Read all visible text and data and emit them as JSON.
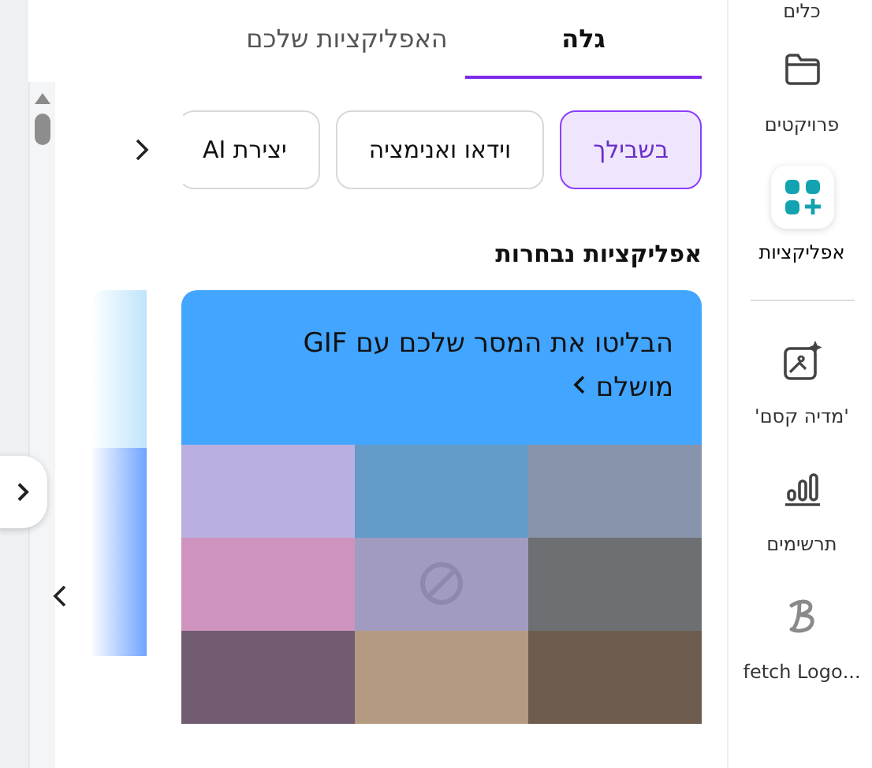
{
  "tabs": [
    {
      "label": "גלה",
      "selected": true
    },
    {
      "label": "האפליקציות שלכם",
      "selected": false
    }
  ],
  "chips": [
    {
      "label": "בשבילך",
      "selected": true
    },
    {
      "label": "וידאו ואנימציה",
      "selected": false
    },
    {
      "label": "יצירת AI",
      "selected": false
    }
  ],
  "section_title": "אפליקציות נבחרות",
  "featured_card": {
    "title": "הבליטו את המסר שלכם עם GIF מושלם",
    "kind": "picture"
  },
  "sidebar": {
    "items": [
      {
        "label": "כלים",
        "kind": "tools",
        "selected": false
      },
      {
        "label": "פרויקטים",
        "kind": "folder",
        "selected": false
      },
      {
        "label": "אפליקציות",
        "kind": "apps",
        "selected": true
      },
      {
        "label": "'מדיה קסם'",
        "kind": "magic",
        "selected": false
      },
      {
        "label": "תרשימים",
        "kind": "charts",
        "selected": false
      },
      {
        "label": "...fetch Logo",
        "kind": "logo",
        "selected": false
      }
    ]
  }
}
